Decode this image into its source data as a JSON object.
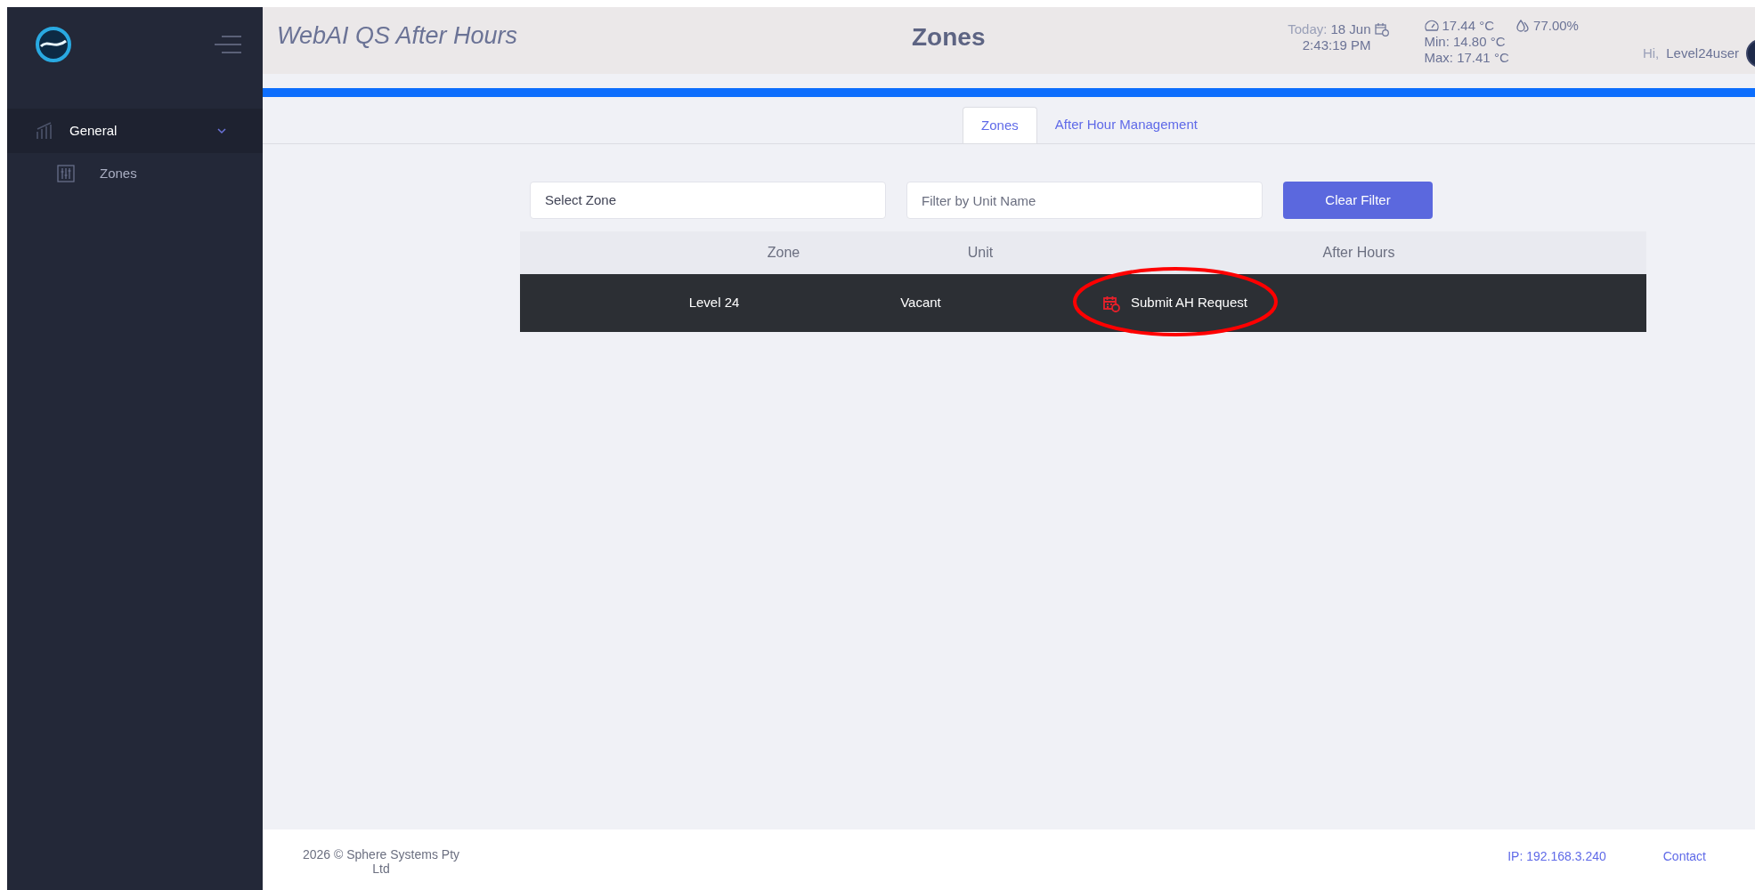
{
  "sidebar": {
    "menu": [
      {
        "label": "General",
        "expanded": true,
        "children": [
          {
            "label": "Zones",
            "selected": false
          }
        ]
      }
    ]
  },
  "header": {
    "app_title": "WebAI QS After Hours",
    "page_title": "Zones",
    "today_label": "Today:",
    "date": "18 Jun",
    "time": "2:43:19 PM",
    "temperature": "17.44 °C",
    "humidity": "77.00%",
    "min": "Min: 14.80 °C",
    "max": "Max: 17.41 °C",
    "greeting": "Hi,",
    "user": "Level24user"
  },
  "tabs": [
    {
      "label": "Zones",
      "selected": true
    },
    {
      "label": "After Hour Management",
      "selected": false
    }
  ],
  "filters": {
    "zone_select": "Select Zone",
    "unit_placeholder": "Filter by Unit Name",
    "clear_button": "Clear Filter"
  },
  "table": {
    "columns": [
      "Zone",
      "Unit",
      "After Hours"
    ],
    "rows": [
      {
        "zone": "Level 24",
        "unit": "Vacant",
        "action": "Submit AH Request",
        "highlighted": true
      }
    ]
  },
  "footer": {
    "copyright": "2026 © Sphere Systems Pty Ltd",
    "ip": "IP: 192.168.3.240",
    "contact": "Contact"
  }
}
